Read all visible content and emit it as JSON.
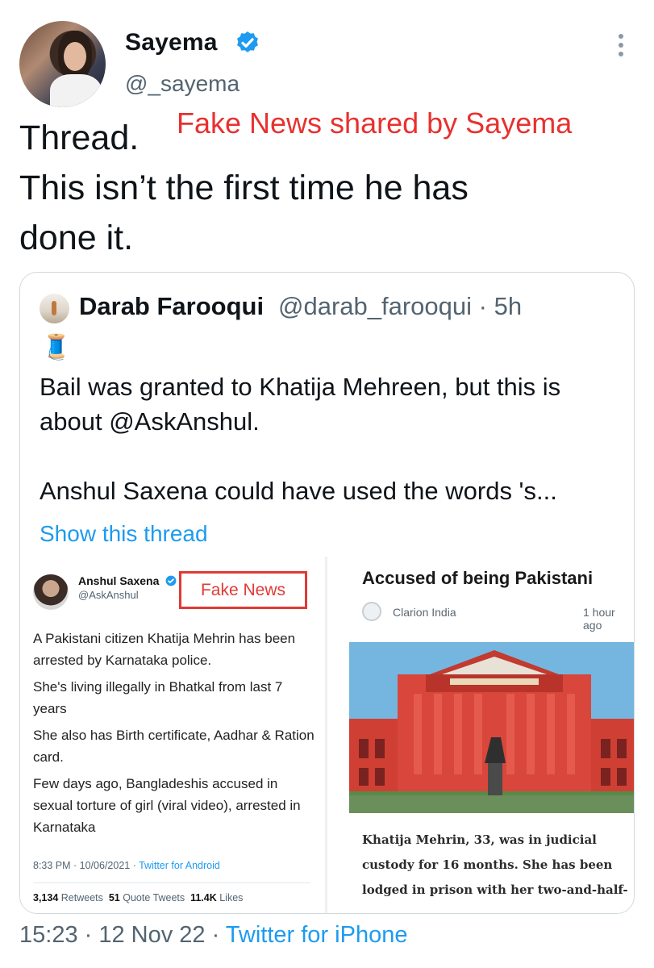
{
  "author": {
    "name": "Sayema",
    "handle": "@_sayema"
  },
  "tweet": {
    "line1": "Thread.",
    "line2": "This isn’t the first time he has",
    "line3": "done it.",
    "overlay": "Fake News shared by Sayema"
  },
  "quoted": {
    "name": "Darab Farooqui",
    "handle_time": "@darab_farooqui · 5h",
    "emoji": "🧵",
    "text1": "Bail was granted to Khatija Mehreen, but this is about @AskAnshul.",
    "text2": "Anshul Saxena could have used the words 's...",
    "show_thread": "Show this thread"
  },
  "left_card": {
    "name": "Anshul Saxena",
    "handle": "@AskAnshul",
    "fake_label": "Fake News",
    "p1": "A Pakistani citizen Khatija Mehrin has been arrested by Karnataka police.",
    "p2": "She's living illegally in Bhatkal from last 7 years",
    "p3": "She also has Birth certificate, Aadhar & Ration card.",
    "p4": "Few days ago, Bangladeshis accused in sexual torture of girl (viral video), arrested in Karnataka",
    "meta_time": "8:33 PM · 10/06/2021 · ",
    "meta_app": "Twitter for Android",
    "retweets": "3,134",
    "retweets_label": "Retweets",
    "quotes": "51",
    "quotes_label": "Quote Tweets",
    "likes": "11.4K",
    "likes_label": "Likes"
  },
  "right_card": {
    "headline": "Accused of being Pakistani",
    "source": "Clarion India",
    "time": "1 hour ago",
    "caption": "Khatija Mehrin, 33, was in judicial custody for 16 months. She has been lodged in prison with her two-and-half-"
  },
  "footer": {
    "time_date": "15:23 · 12 Nov 22 · ",
    "app": "Twitter for iPhone"
  },
  "colors": {
    "link_blue": "#1d9bf0",
    "overlay_red": "#e8312f",
    "building_red": "#d9463b"
  }
}
